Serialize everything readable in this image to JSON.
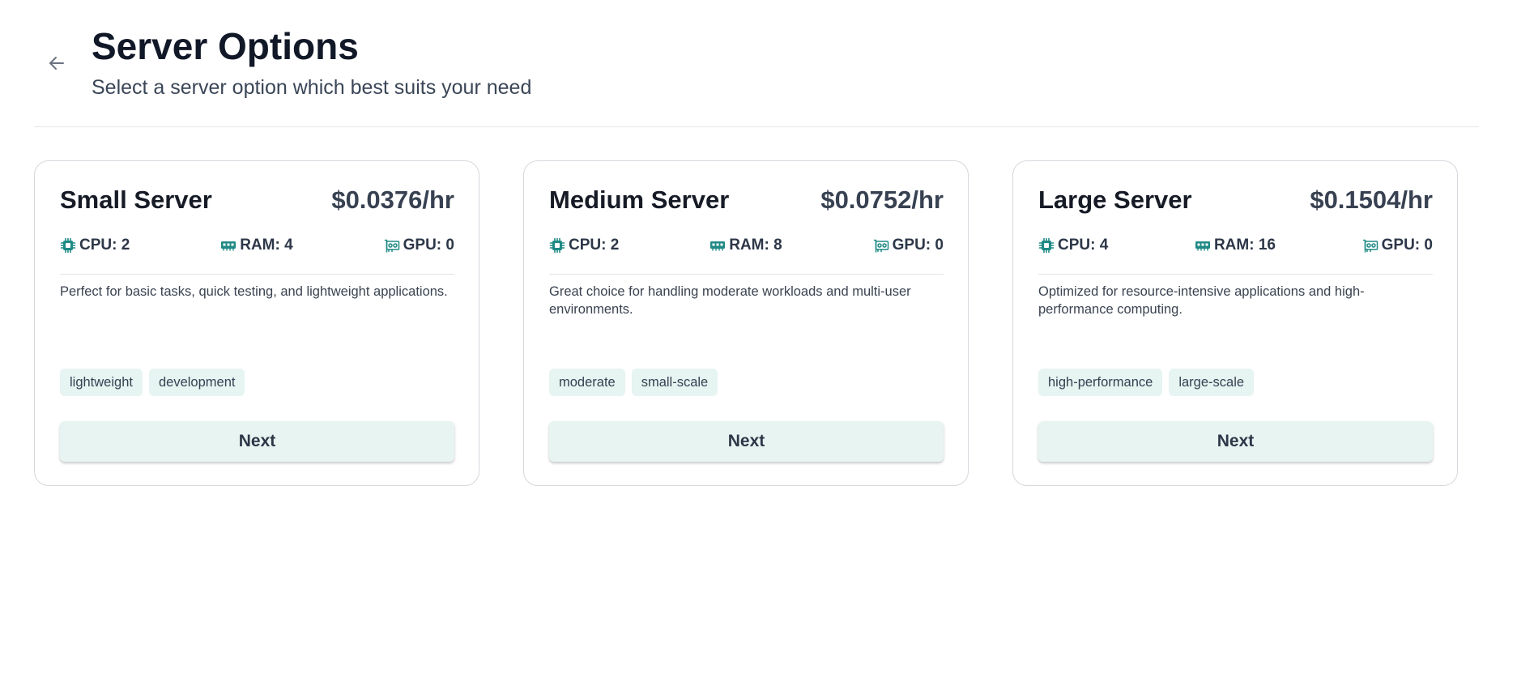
{
  "header": {
    "title": "Server Options",
    "subtitle": "Select a server option which best suits your need",
    "back_icon": "arrow-left-icon"
  },
  "colors": {
    "accent": "#1f8a85",
    "tag_bg": "#e6f4f2",
    "button_bg": "#e7f4f2"
  },
  "servers": [
    {
      "name": "Small Server",
      "price": "$0.0376/hr",
      "cpu": "CPU: 2",
      "ram": "RAM: 4",
      "gpu": "GPU: 0",
      "description": "Perfect for basic tasks, quick testing, and lightweight applications.",
      "tags": [
        "lightweight",
        "development"
      ],
      "button_label": "Next"
    },
    {
      "name": "Medium Server",
      "price": "$0.0752/hr",
      "cpu": "CPU: 2",
      "ram": "RAM: 8",
      "gpu": "GPU: 0",
      "description": "Great choice for handling moderate workloads and multi-user environments.",
      "tags": [
        "moderate",
        "small-scale"
      ],
      "button_label": "Next"
    },
    {
      "name": "Large Server",
      "price": "$0.1504/hr",
      "cpu": "CPU: 4",
      "ram": "RAM: 16",
      "gpu": "GPU: 0",
      "description": "Optimized for resource-intensive applications and high-performance computing.",
      "tags": [
        "high-performance",
        "large-scale"
      ],
      "button_label": "Next"
    }
  ]
}
